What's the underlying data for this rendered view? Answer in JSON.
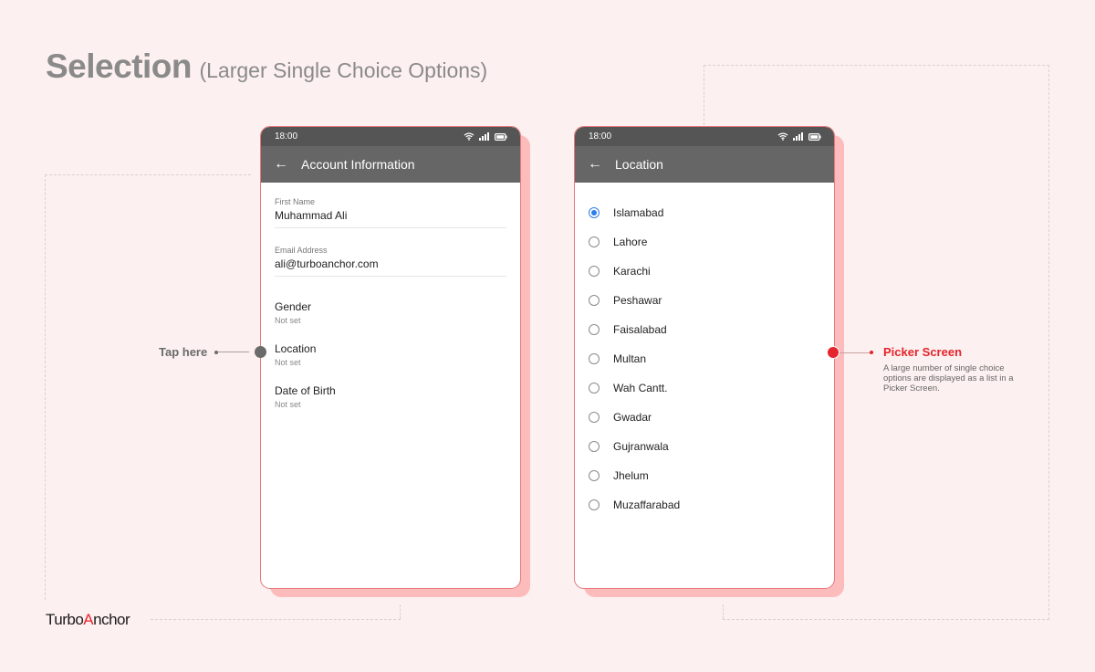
{
  "header": {
    "title": "Selection",
    "subtitle": "(Larger Single Choice Options)"
  },
  "colors": {
    "background": "#fdf0f0",
    "accent_red": "#e5242c",
    "radio_selected": "#2b7de9",
    "appbar": "#666666",
    "statusbar": "#555555"
  },
  "left_phone": {
    "status_time": "18:00",
    "status_icons": [
      "wifi-icon",
      "signal-icon",
      "battery-icon"
    ],
    "back_icon": "←",
    "title": "Account Information",
    "fields": [
      {
        "label": "First Name",
        "value": "Muhammad Ali"
      },
      {
        "label": "Email Address",
        "value": "ali@turboanchor.com"
      }
    ],
    "settings": [
      {
        "name": "Gender",
        "value": "Not set"
      },
      {
        "name": "Location",
        "value": "Not set"
      },
      {
        "name": "Date of Birth",
        "value": "Not set"
      }
    ]
  },
  "right_phone": {
    "status_time": "18:00",
    "status_icons": [
      "wifi-icon",
      "signal-icon",
      "battery-icon"
    ],
    "back_icon": "←",
    "title": "Location",
    "selected": "Islamabad",
    "options": [
      "Islamabad",
      "Lahore",
      "Karachi",
      "Peshawar",
      "Faisalabad",
      "Multan",
      "Wah Cantt.",
      "Gwadar",
      "Gujranwala",
      "Jhelum",
      "Muzaffarabad"
    ]
  },
  "annotations": {
    "tap_here": "Tap here",
    "picker_title": "Picker Screen",
    "picker_desc": "A large number of single choice options are displayed as a list in a Picker Screen."
  },
  "logo": {
    "part1": "Turbo",
    "accent": "A",
    "part2": "nchor"
  }
}
